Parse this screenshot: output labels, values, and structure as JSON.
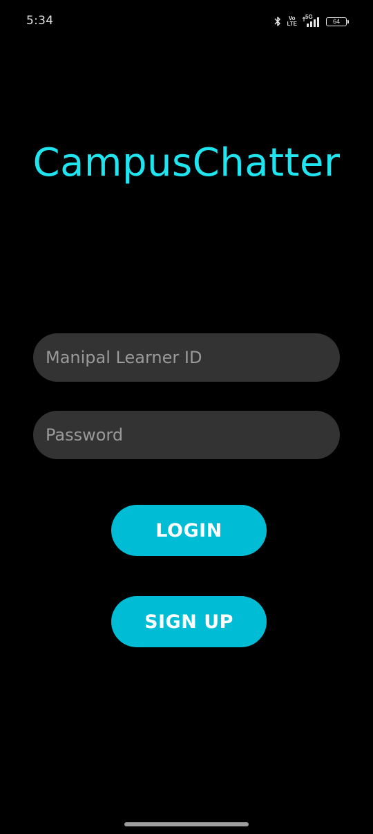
{
  "status_bar": {
    "time": "5:34",
    "volte_label_top": "Vo",
    "volte_label_bottom": "LTE",
    "network_label": "5G",
    "battery_level": "64",
    "icons": [
      "bluetooth-icon",
      "volte-icon",
      "signal-icon",
      "battery-icon"
    ]
  },
  "app": {
    "title": "CampusChatter",
    "accent_color": "#1fe5f0",
    "button_color": "#00bcd4",
    "field_color": "#333333",
    "background_color": "#000000"
  },
  "form": {
    "learner_id": {
      "placeholder": "Manipal Learner ID",
      "value": ""
    },
    "password": {
      "placeholder": "Password",
      "value": ""
    },
    "login_label": "LOGIN",
    "signup_label": "SIGN UP"
  }
}
